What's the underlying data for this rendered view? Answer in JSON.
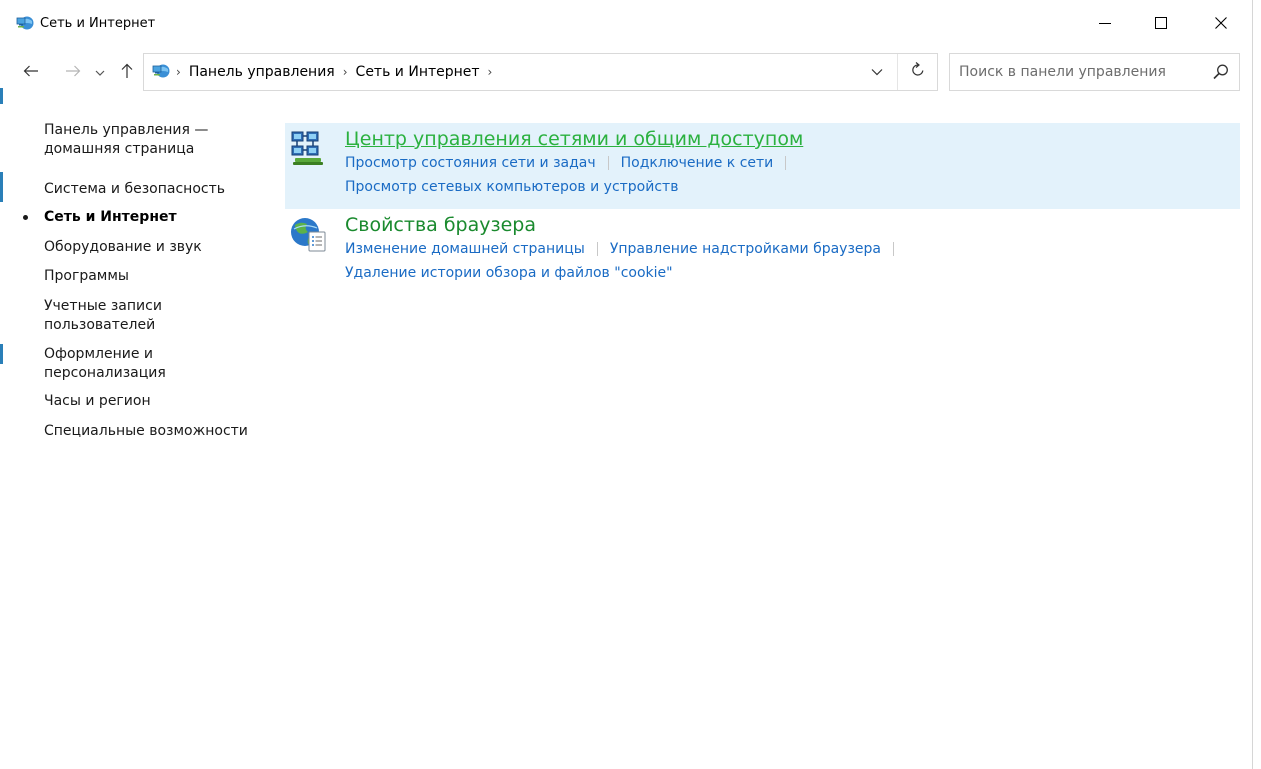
{
  "window": {
    "title": "Сеть и Интернет",
    "accent_color": "#2a7fb8"
  },
  "window_controls": {
    "minimize_icon": "minimize-icon",
    "maximize_icon": "maximize-icon",
    "close_icon": "close-icon"
  },
  "address_bar": {
    "breadcrumbs": [
      "Панель управления",
      "Сеть и Интернет"
    ],
    "dropdown_icon": "chevron-down-icon",
    "refresh_icon": "refresh-icon"
  },
  "search": {
    "placeholder": "Поиск в панели управления",
    "value": ""
  },
  "left_nav": {
    "items": [
      {
        "label": "Панель управления — домашняя страница",
        "current": false
      },
      {
        "label": "Система и безопасность",
        "current": false
      },
      {
        "label": "Сеть и Интернет",
        "current": true
      },
      {
        "label": "Оборудование и звук",
        "current": false
      },
      {
        "label": "Программы",
        "current": false
      },
      {
        "label": "Учетные записи пользователей",
        "current": false
      },
      {
        "label": "Оформление и персонализация",
        "current": false
      },
      {
        "label": "Часы и регион",
        "current": false
      },
      {
        "label": "Специальные возможности",
        "current": false
      }
    ]
  },
  "categories": [
    {
      "title": "Центр управления сетями и общим доступом",
      "icon": "network-center-icon",
      "highlight_color": "#e3f2fb",
      "title_color": "#2bb13f",
      "links": [
        "Просмотр состояния сети и задач",
        "Подключение к сети",
        "Просмотр сетевых компьютеров и устройств"
      ]
    },
    {
      "title": "Свойства браузера",
      "icon": "internet-options-icon",
      "title_color": "#1a8a2e",
      "links": [
        "Изменение домашней страницы",
        "Управление надстройками браузера",
        "Удаление истории обзора и файлов \"cookie\""
      ]
    }
  ],
  "colors": {
    "link": "#1a6bc4",
    "category_title": "#1a8a2e",
    "category_title_hover": "#2bb13f"
  }
}
